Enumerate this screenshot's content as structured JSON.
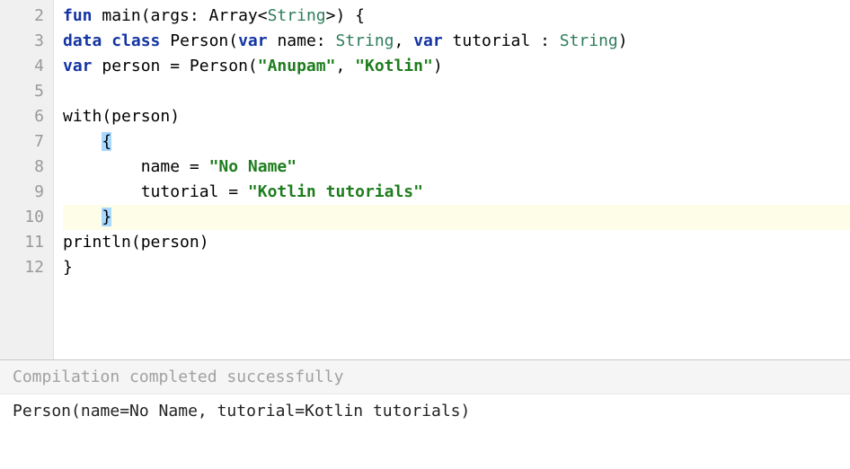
{
  "editor": {
    "line_numbers": [
      "2",
      "3",
      "4",
      "5",
      "6",
      "7",
      "8",
      "9",
      "10",
      "11",
      "12"
    ],
    "lines": {
      "l2": {
        "t1": "fun",
        "t2": " main(args: Array<",
        "t3": "String",
        "t4": ">) {"
      },
      "l3": {
        "t1": "data",
        "t2": " ",
        "t3": "class",
        "t4": " Person(",
        "t5": "var",
        "t6": " name: ",
        "t7": "String",
        "t8": ", ",
        "t9": "var",
        "t10": " tutorial : ",
        "t11": "String",
        "t12": ")"
      },
      "l4": {
        "t1": "var",
        "t2": " person = Person(",
        "t3": "\"Anupam\"",
        "t4": ", ",
        "t5": "\"Kotlin\"",
        "t6": ")"
      },
      "l5": {
        "t1": ""
      },
      "l6": {
        "t1": "with(person)"
      },
      "l7": {
        "indent": "    ",
        "brace": "{"
      },
      "l8": {
        "t1": "        name = ",
        "t2": "\"No Name\""
      },
      "l9": {
        "t1": "        tutorial = ",
        "t2": "\"Kotlin tutorials\""
      },
      "l10": {
        "indent": "    ",
        "brace": "}"
      },
      "l11": {
        "t1": "println(person)"
      },
      "l12": {
        "t1": "}"
      }
    }
  },
  "console": {
    "status": "Compilation completed successfully",
    "output": "Person(name=No Name, tutorial=Kotlin tutorials)"
  },
  "chart_data": null
}
